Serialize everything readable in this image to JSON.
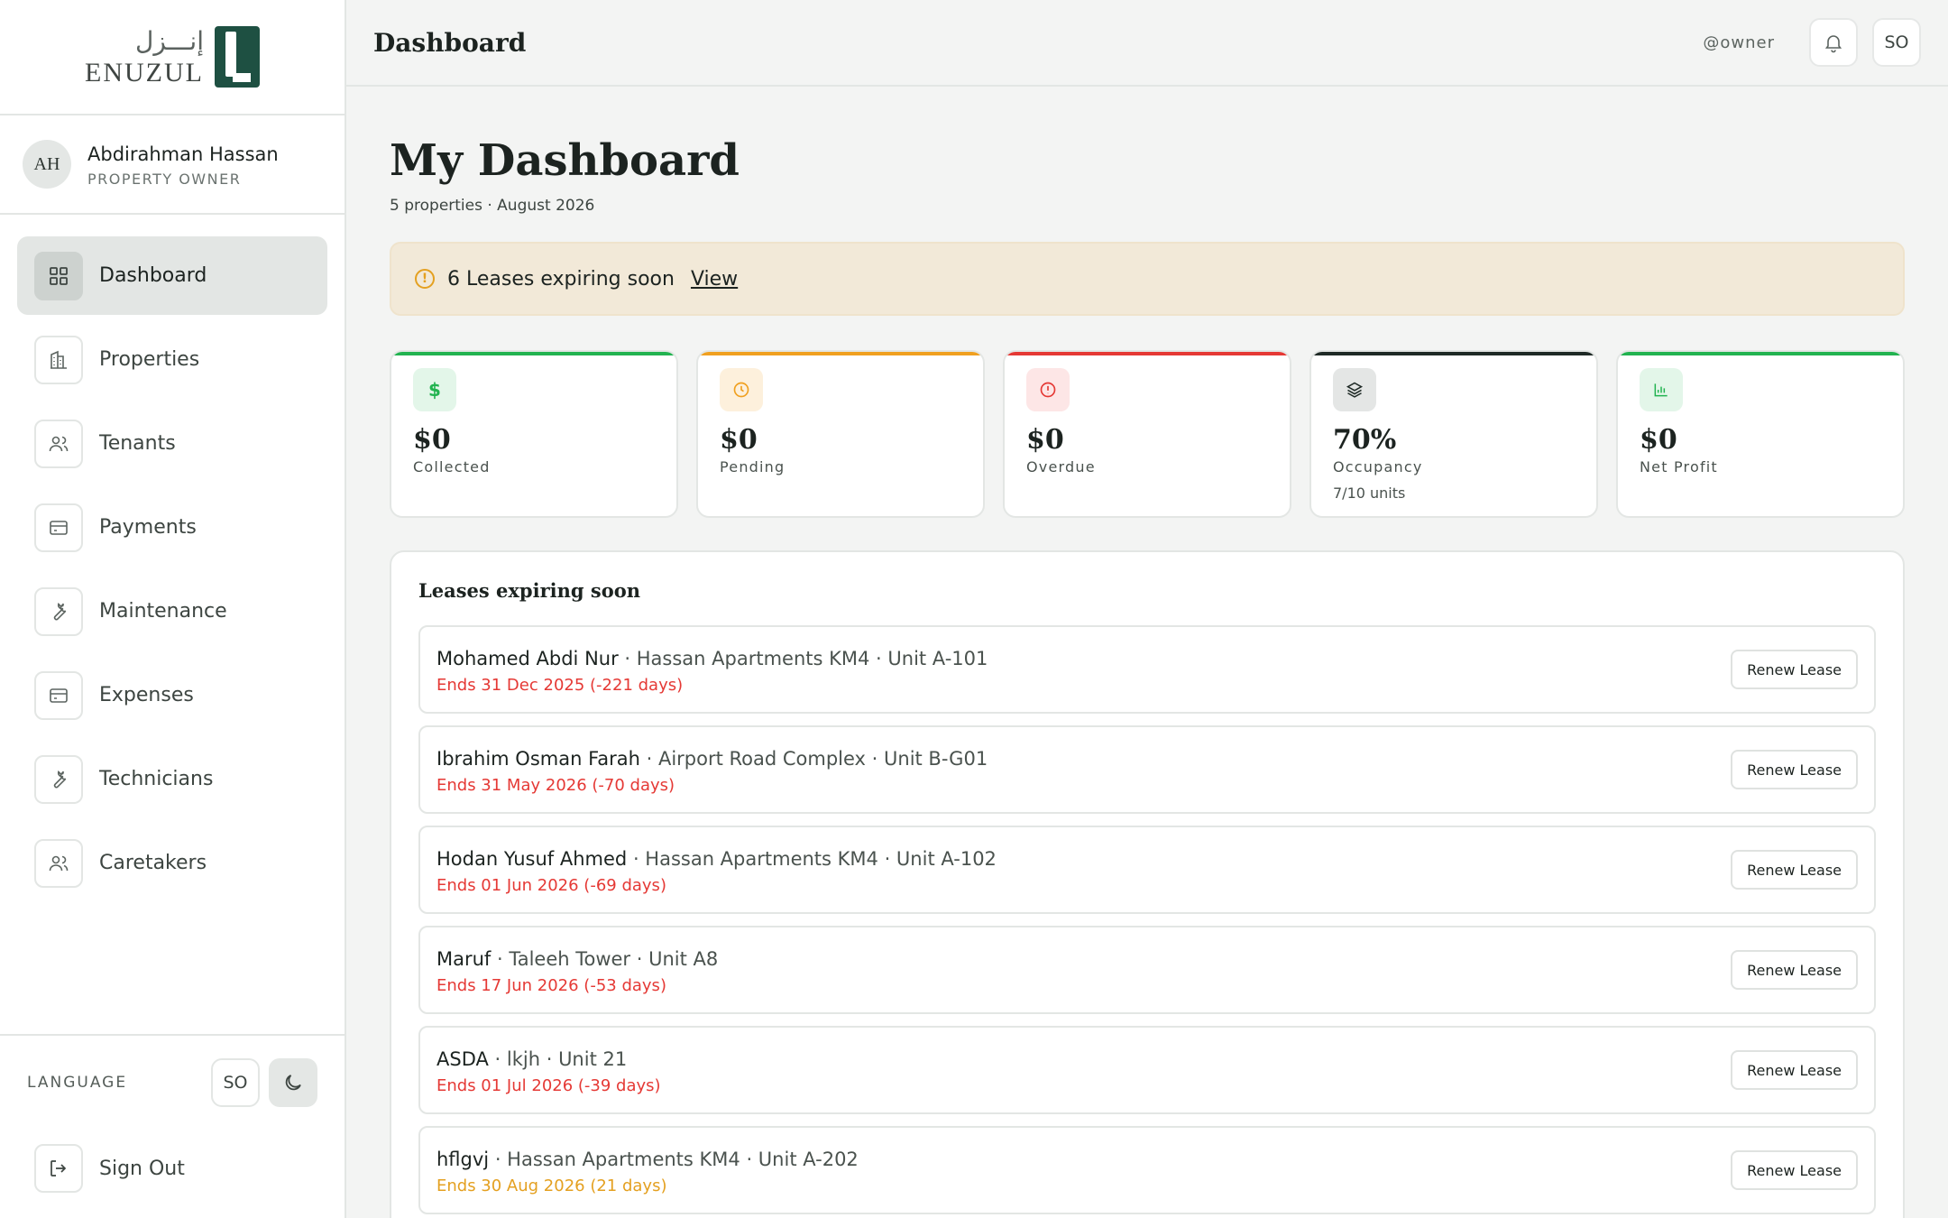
{
  "brand": {
    "arabic": "إنـــزل",
    "latin": "ENUZUL"
  },
  "profile": {
    "initials": "AH",
    "name": "Abdirahman Hassan",
    "role": "PROPERTY OWNER"
  },
  "nav": [
    {
      "label": "Dashboard",
      "icon": "grid-icon",
      "active": true
    },
    {
      "label": "Properties",
      "icon": "building-icon"
    },
    {
      "label": "Tenants",
      "icon": "users-icon"
    },
    {
      "label": "Payments",
      "icon": "card-icon"
    },
    {
      "label": "Maintenance",
      "icon": "wrench-icon"
    },
    {
      "label": "Expenses",
      "icon": "card-icon"
    },
    {
      "label": "Technicians",
      "icon": "wrench-icon"
    },
    {
      "label": "Caretakers",
      "icon": "users-icon"
    }
  ],
  "sidebar_bottom": {
    "language_label": "LANGUAGE",
    "language_code": "SO",
    "signout": "Sign Out"
  },
  "topbar": {
    "title": "Dashboard",
    "username": "@owner",
    "lang": "SO"
  },
  "page": {
    "title": "My Dashboard",
    "subtitle": "5 properties · August 2026"
  },
  "alert": {
    "text": "6 Leases expiring soon",
    "link": "View"
  },
  "stats": [
    {
      "value": "$0",
      "label": "Collected",
      "color": "#22b350",
      "icon_bg": "#e3f6e9",
      "icon": "$"
    },
    {
      "value": "$0",
      "label": "Pending",
      "color": "#f0a020",
      "icon_bg": "#fdf0dc",
      "icon": "clock"
    },
    {
      "value": "$0",
      "label": "Overdue",
      "color": "#e53935",
      "icon_bg": "#fde6e6",
      "icon": "alert"
    },
    {
      "value": "70%",
      "label": "Occupancy",
      "sub": "7/10 units",
      "color": "#1f2a26",
      "icon_bg": "#e4e6e5",
      "icon": "layers"
    },
    {
      "value": "$0",
      "label": "Net Profit",
      "color": "#22b350",
      "icon_bg": "#e3f6e9",
      "icon": "chart"
    }
  ],
  "leases": {
    "title": "Leases expiring soon",
    "button": "Renew Lease",
    "items": [
      {
        "name": "Mohamed Abdi Nur",
        "detail": " · Hassan Apartments KM4 · Unit A-101",
        "ends": "Ends 31 Dec 2025 (-221 days)",
        "color": "#e53935"
      },
      {
        "name": "Ibrahim Osman Farah",
        "detail": " · Airport Road Complex · Unit B-G01",
        "ends": "Ends 31 May 2026 (-70 days)",
        "color": "#e53935"
      },
      {
        "name": "Hodan Yusuf Ahmed",
        "detail": " · Hassan Apartments KM4 · Unit A-102",
        "ends": "Ends 01 Jun 2026 (-69 days)",
        "color": "#e53935"
      },
      {
        "name": "Maruf",
        "detail": " · Taleeh Tower · Unit A8",
        "ends": "Ends 17 Jun 2026 (-53 days)",
        "color": "#e53935"
      },
      {
        "name": "ASDA",
        "detail": " · lkjh · Unit 21",
        "ends": "Ends 01 Jul 2026 (-39 days)",
        "color": "#e53935"
      },
      {
        "name": "hflgvj",
        "detail": " · Hassan Apartments KM4 · Unit A-202",
        "ends": "Ends 30 Aug 2026 (21 days)",
        "color": "#e4a020"
      }
    ]
  }
}
